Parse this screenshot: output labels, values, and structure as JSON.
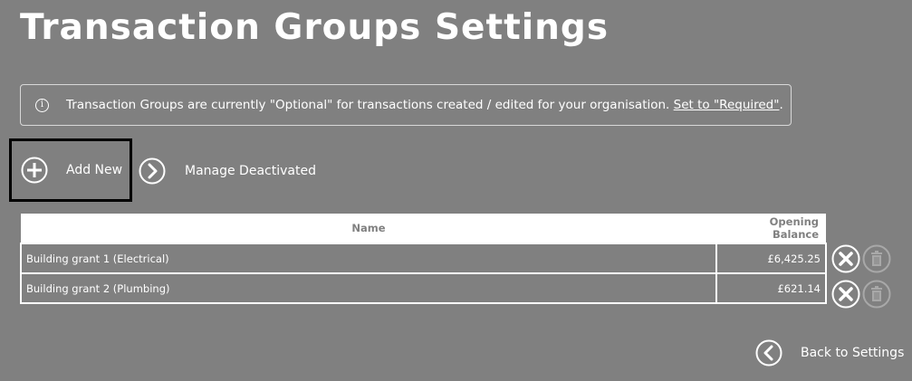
{
  "header": {
    "title": "Transaction Groups Settings"
  },
  "info": {
    "icon": "info-icon",
    "message": "Transaction Groups are currently \"Optional\" for transactions created / edited for your organisation.",
    "link_label": "Set to \"Required\"",
    "suffix": "."
  },
  "actions": {
    "add_new_label": "Add New",
    "add_new_icon": "plus-circle-icon",
    "manage_deactivated_label": "Manage Deactivated",
    "manage_deactivated_icon": "chevron-right-circle-icon",
    "back_label": "Back to Settings",
    "back_icon": "chevron-left-circle-icon"
  },
  "table": {
    "columns": [
      "Name",
      "Opening Balance"
    ],
    "rows": [
      {
        "name": "Building grant 1 (Electrical)",
        "balance": "£6,425.25"
      },
      {
        "name": "Building grant 2 (Plumbing)",
        "balance": "£621.14"
      }
    ],
    "row_action_icons": [
      "close-circle-icon",
      "trash-icon"
    ]
  },
  "colors": {
    "background": "#808080",
    "text": "#ffffff",
    "header_text": "#808080",
    "disabled_icon": "#a8a8a8",
    "highlight_border": "#000000"
  }
}
